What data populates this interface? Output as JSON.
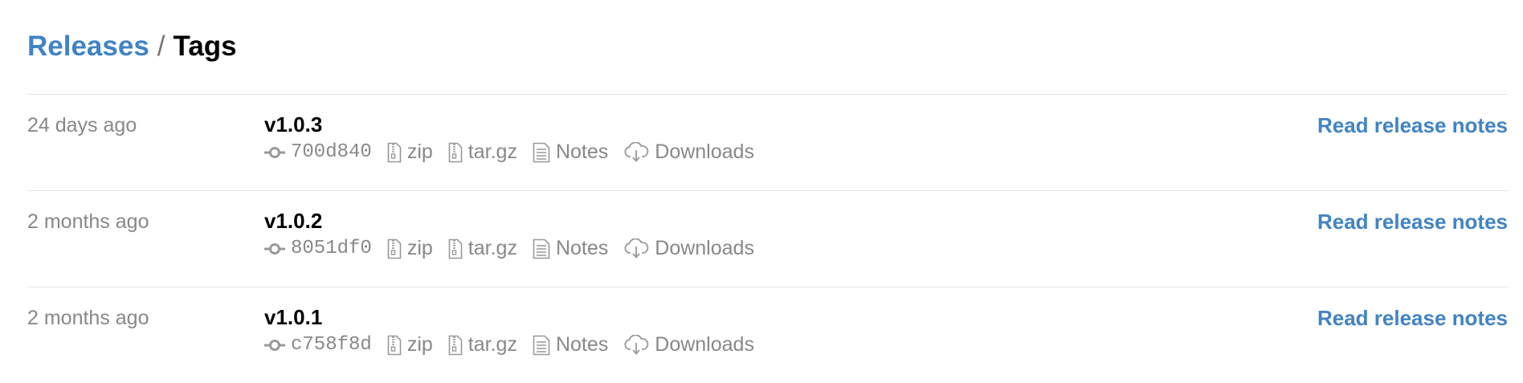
{
  "breadcrumb": {
    "releases_label": "Releases",
    "separator": "/",
    "tags_label": "Tags"
  },
  "colors": {
    "link": "#4183c4",
    "muted": "#888888",
    "divider": "#e5e5e5"
  },
  "icons": {
    "commit": "commit-icon",
    "zip": "file-zip-icon",
    "targz": "file-zip-icon",
    "notes": "file-text-icon",
    "downloads": "cloud-download-icon"
  },
  "tags": [
    {
      "date": "24 days ago",
      "name": "v1.0.3",
      "sha": "700d840",
      "zip_label": "zip",
      "targz_label": "tar.gz",
      "notes_label": "Notes",
      "downloads_label": "Downloads",
      "release_notes_link": "Read release notes"
    },
    {
      "date": "2 months ago",
      "name": "v1.0.2",
      "sha": "8051df0",
      "zip_label": "zip",
      "targz_label": "tar.gz",
      "notes_label": "Notes",
      "downloads_label": "Downloads",
      "release_notes_link": "Read release notes"
    },
    {
      "date": "2 months ago",
      "name": "v1.0.1",
      "sha": "c758f8d",
      "zip_label": "zip",
      "targz_label": "tar.gz",
      "notes_label": "Notes",
      "downloads_label": "Downloads",
      "release_notes_link": "Read release notes"
    }
  ]
}
